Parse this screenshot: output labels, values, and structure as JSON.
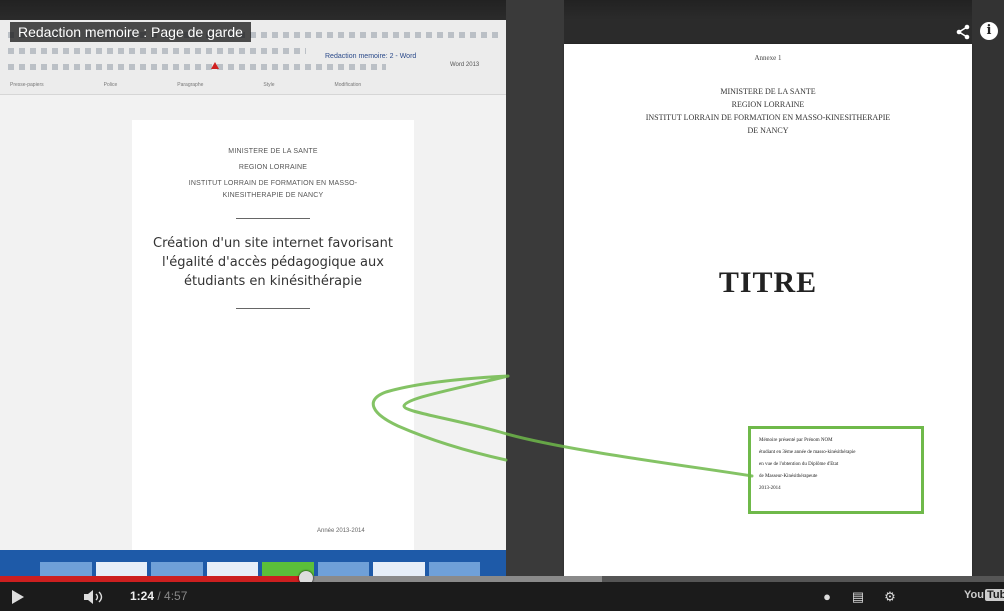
{
  "video": {
    "title": "Redaction memoire : Page de garde",
    "time_current": "1:24",
    "time_separator": " / ",
    "time_duration": "4:57",
    "progress_played_fraction": 0.305,
    "progress_buffered_fraction": 0.6,
    "youtube_label": "You",
    "youtube_tube": "Tube",
    "icons": {
      "share": "share-icon",
      "info": "info-icon",
      "play": "play-icon",
      "volume": "volume-icon",
      "captions": "captions-icon",
      "annotations": "annotations-icon",
      "settings": "gear-icon",
      "fullscreen": "fullscreen-icon"
    },
    "colors": {
      "progress_played": "#cc1f1f",
      "annotation_green": "#6fb94a",
      "taskbar_blue": "#1e5aa8"
    }
  },
  "left_doc": {
    "ribbon_title": "Redaction memoire: 2 - Word",
    "ribbon_tag": "Word 2013",
    "ribbon_labels": [
      "Presse-papiers",
      "Police",
      "Paragraphe",
      "Style",
      "Modification"
    ],
    "header_lines": [
      "MINISTERE DE LA SANTE",
      "REGION LORRAINE",
      "INSTITUT LORRAIN DE FORMATION EN MASSO-",
      "KINESITHERAPIE DE NANCY"
    ],
    "title_lines": [
      "Création d'un site internet favorisant",
      "l'égalité d'accès pédagogique aux",
      "étudiants en kinésithérapie"
    ],
    "year": "Année 2013-2014"
  },
  "right_doc": {
    "annex": "Annexe 1",
    "header_lines": [
      "MINISTERE DE LA SANTE",
      "REGION LORRAINE",
      "INSTITUT LORRAIN DE FORMATION EN MASSO-KINESITHERAPIE",
      "DE NANCY"
    ],
    "titre": "TITRE",
    "box_lines": [
      "Mémoire présenté par Prénom NOM",
      "étudiant en 3ème année de masso-kinésithérapie",
      "en vue de l'obtention du Diplôme d'Etat",
      "de Masseur-Kinésithérapeute",
      "2013-2014"
    ]
  }
}
